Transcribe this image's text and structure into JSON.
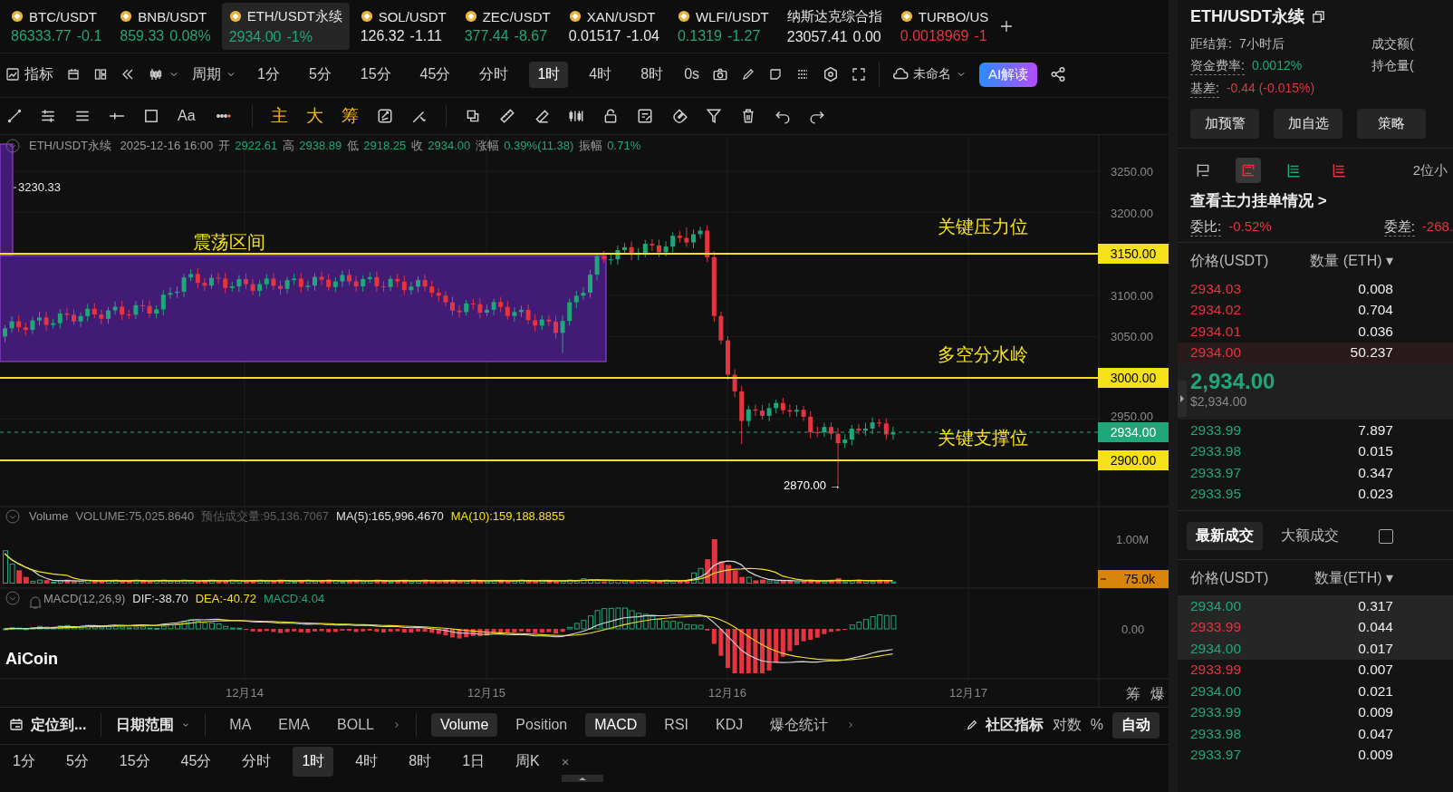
{
  "tickers": [
    {
      "symbol": "BTC/USDT",
      "price": "86333.77",
      "change": "-0.1",
      "color": "#1fa67a",
      "icon": true,
      "selected": false
    },
    {
      "symbol": "BNB/USDT",
      "price": "859.33",
      "change": "0.08%",
      "color": "#1fa67a",
      "icon": true,
      "selected": false
    },
    {
      "symbol": "ETH/USDT永续",
      "price": "2934.00",
      "change": "-1%",
      "color": "#1fa67a",
      "icon": true,
      "selected": true
    },
    {
      "symbol": "SOL/USDT",
      "price": "126.32",
      "change": "-1.11",
      "color": "#e6e6e6",
      "icon": true,
      "selected": false
    },
    {
      "symbol": "ZEC/USDT",
      "price": "377.44",
      "change": "-8.67",
      "color": "#1fa67a",
      "icon": true,
      "selected": false
    },
    {
      "symbol": "XAN/USDT",
      "price": "0.01517",
      "change": "-1.04",
      "color": "#e6e6e6",
      "icon": true,
      "selected": false
    },
    {
      "symbol": "WLFI/USDT",
      "price": "0.1319",
      "change": "-1.27",
      "color": "#1fa67a",
      "icon": true,
      "selected": false
    },
    {
      "symbol": "纳斯达克综合指",
      "price": "23057.41",
      "change": "0.00",
      "color": "#e6e6e6",
      "icon": false,
      "selected": false
    },
    {
      "symbol": "TURBO/US",
      "price": "0.0018969",
      "change": "-1",
      "color": "#e5343f",
      "icon": true,
      "selected": false
    }
  ],
  "toolbar": {
    "indicators_label": "指标",
    "period_label": "周期",
    "periods": [
      {
        "label": "1分",
        "selected": false
      },
      {
        "label": "5分",
        "selected": false
      },
      {
        "label": "15分",
        "selected": false
      },
      {
        "label": "45分",
        "selected": false
      },
      {
        "label": "分时",
        "selected": false
      },
      {
        "label": "1时",
        "selected": true
      },
      {
        "label": "4时",
        "selected": false
      },
      {
        "label": "8时",
        "selected": false
      }
    ],
    "countdown": "0s",
    "layout_name": "未命名",
    "ai_button": "AI解读"
  },
  "drawing_tools": {
    "text_tool": "Aa",
    "chip_labels": [
      "主",
      "大",
      "筹"
    ]
  },
  "chart": {
    "info": {
      "symbol": "ETH/USDT永续",
      "time": "2025-12-16 16:00",
      "fields": [
        {
          "label": "开",
          "value": "2922.61"
        },
        {
          "label": "高",
          "value": "2938.89"
        },
        {
          "label": "低",
          "value": "2918.25"
        },
        {
          "label": "收",
          "value": "2934.00"
        },
        {
          "label": "涨幅",
          "value": "0.39%(11.38)"
        },
        {
          "label": "振幅",
          "value": "0.71%"
        }
      ]
    },
    "price_ticks": [
      "3250.00",
      "3200.00",
      "3100.00",
      "3050.00",
      "2950.00"
    ],
    "levels": [
      {
        "label": "3150.00",
        "kind": "line"
      },
      {
        "label": "3000.00",
        "kind": "line"
      },
      {
        "label": "2934.00",
        "kind": "last"
      },
      {
        "label": "2900.00",
        "kind": "line"
      }
    ],
    "range_label": "震荡区间",
    "high_label": "3230.33",
    "low_label": "2870.00 →",
    "annotations": [
      "关键压力位",
      "多空分水岭",
      "关键支撑位"
    ],
    "volume": {
      "title": "Volume",
      "legend": [
        {
          "text": "VOLUME:75,025.8640",
          "color": "#8a8a8a"
        },
        {
          "text": "预估成交量:95,136.7067",
          "color": "#5e5e5e"
        },
        {
          "text": "MA(5):165,996.4670",
          "color": "#e0e0e0"
        },
        {
          "text": "MA(10):159,188.8855",
          "color": "#f5e11a"
        }
      ],
      "ticks": [
        "1.00M"
      ],
      "current": "75.0k"
    },
    "macd": {
      "title": "MACD(12,26,9)",
      "legend": [
        {
          "text": "DIF:-38.70",
          "color": "#e0e0e0"
        },
        {
          "text": "DEA:-40.72",
          "color": "#f5e11a"
        },
        {
          "text": "MACD:4.04",
          "color": "#1fa67a"
        }
      ],
      "ticks": [
        "0.00"
      ]
    },
    "logo": "AiCoin",
    "dates": [
      "12月14",
      "12月15",
      "12月16",
      "12月17"
    ],
    "axis_tools": [
      "筹",
      "爆"
    ]
  },
  "bottom_bar": {
    "locate": "定位到...",
    "date_range": "日期范围",
    "main_indicators": [
      {
        "label": "MA",
        "selected": false
      },
      {
        "label": "EMA",
        "selected": false
      },
      {
        "label": "BOLL",
        "selected": false
      }
    ],
    "sub_indicators": [
      {
        "label": "Volume",
        "selected": true
      },
      {
        "label": "Position",
        "selected": false
      },
      {
        "label": "MACD",
        "selected": true
      },
      {
        "label": "RSI",
        "selected": false
      },
      {
        "label": "KDJ",
        "selected": false
      },
      {
        "label": "爆仓统计",
        "selected": false
      }
    ],
    "community": "社区指标",
    "log": "对数",
    "percent": "%",
    "auto": {
      "label": "自动",
      "selected": true
    }
  },
  "period_bar": {
    "periods": [
      {
        "label": "1分",
        "selected": false
      },
      {
        "label": "5分",
        "selected": false
      },
      {
        "label": "15分",
        "selected": false
      },
      {
        "label": "45分",
        "selected": false
      },
      {
        "label": "分时",
        "selected": false
      },
      {
        "label": "1时",
        "selected": true
      },
      {
        "label": "4时",
        "selected": false
      },
      {
        "label": "8时",
        "selected": false
      },
      {
        "label": "1日",
        "selected": false
      },
      {
        "label": "周K",
        "selected": false
      }
    ],
    "close": "×"
  },
  "side_panel": {
    "title": "ETH/USDT永续",
    "stats": [
      {
        "label": "距结算:",
        "value": "7小时后",
        "color": "#bdbdbd"
      },
      {
        "label": "成交额("
      },
      {
        "label": "资金费率:",
        "value": "0.0012%",
        "color": "#1fa67a"
      },
      {
        "label": "持仓量("
      },
      {
        "label": "基差:",
        "value": "-0.44 (-0.015%)",
        "color": "#e5343f"
      }
    ],
    "buttons": [
      "加预警",
      "加自选",
      "策略"
    ],
    "view_tabs": [
      {
        "selected": false
      },
      {
        "selected": true
      },
      {
        "selected": false
      },
      {
        "selected": false
      }
    ],
    "precision": "2位小",
    "depth_link": "查看主力挂单情况 >",
    "ratios": [
      {
        "label": "委比:",
        "value": "-0.52%"
      },
      {
        "label": "委差:",
        "value": "-268."
      }
    ],
    "book_header": [
      "价格(USDT)",
      "数量 (ETH) ▾"
    ],
    "asks": [
      {
        "price": "2934.03",
        "amount": "0.008",
        "highlighted": false
      },
      {
        "price": "2934.02",
        "amount": "0.704",
        "highlighted": false
      },
      {
        "price": "2934.01",
        "amount": "0.036",
        "highlighted": false
      },
      {
        "price": "2934.00",
        "amount": "50.237",
        "highlighted": true
      }
    ],
    "last_price": "2,934.00",
    "last_price_usd": "$2,934.00",
    "bids": [
      {
        "price": "2933.99",
        "amount": "7.897"
      },
      {
        "price": "2933.98",
        "amount": "0.015"
      },
      {
        "price": "2933.97",
        "amount": "0.347"
      },
      {
        "price": "2933.95",
        "amount": "0.023"
      }
    ],
    "trade_tabs": [
      {
        "label": "最新成交",
        "selected": true
      },
      {
        "label": "大额成交",
        "selected": false
      }
    ],
    "filter_checked": false,
    "trades_header": [
      "价格(USDT)",
      "数量(ETH) ▾"
    ],
    "trades": [
      {
        "price": "2934.00",
        "amount": "0.317",
        "color": "#1fa67a",
        "highlighted": true
      },
      {
        "price": "2933.99",
        "amount": "0.044",
        "color": "#e5343f",
        "highlighted": true
      },
      {
        "price": "2934.00",
        "amount": "0.017",
        "color": "#1fa67a",
        "highlighted": true
      },
      {
        "price": "2933.99",
        "amount": "0.007",
        "color": "#e5343f",
        "highlighted": false
      },
      {
        "price": "2934.00",
        "amount": "0.021",
        "color": "#1fa67a",
        "highlighted": false
      },
      {
        "price": "2933.99",
        "amount": "0.009",
        "color": "#1fa67a",
        "highlighted": false
      },
      {
        "price": "2933.98",
        "amount": "0.047",
        "color": "#1fa67a",
        "highlighted": false
      },
      {
        "price": "2933.97",
        "amount": "0.009",
        "color": "#1fa67a",
        "highlighted": false
      }
    ]
  }
}
